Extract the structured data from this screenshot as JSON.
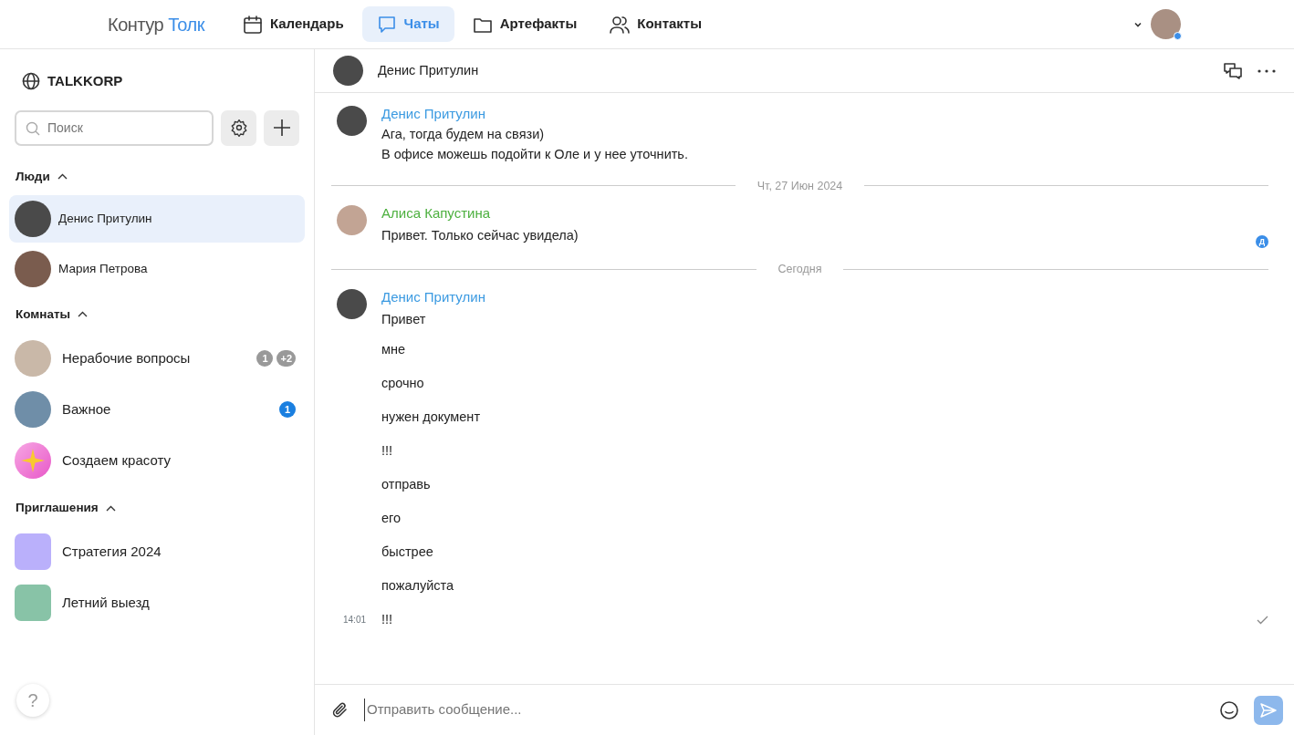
{
  "header": {
    "logo": {
      "brand": "Контур",
      "product": "Толк"
    },
    "nav": [
      {
        "label": "Календарь",
        "selected": false
      },
      {
        "label": "Чаты",
        "selected": true
      },
      {
        "label": "Артефакты",
        "selected": false
      },
      {
        "label": "Контакты",
        "selected": false
      }
    ],
    "user": {
      "online": true
    }
  },
  "sidebar": {
    "workspace": "TALKKORP",
    "search": {
      "placeholder": "Поиск"
    },
    "sections": [
      {
        "title": "Люди",
        "expanded": true,
        "items": [
          {
            "name": "Денис Притулин",
            "kind": "person",
            "selected": true
          },
          {
            "name": "Мария Петрова",
            "kind": "person",
            "selected": false
          }
        ]
      },
      {
        "title": "Комнаты",
        "expanded": true,
        "items": [
          {
            "name": "Нерабочие вопросы",
            "kind": "photo",
            "selected": false,
            "badges": [
              {
                "text": "1",
                "kind": "muted"
              },
              {
                "text": "+2",
                "kind": "muted"
              }
            ]
          },
          {
            "name": "Важное",
            "kind": "photo",
            "selected": false,
            "badges": [
              {
                "text": "1",
                "kind": "unread"
              }
            ]
          },
          {
            "name": "Создаем красоту",
            "kind": "sparkle",
            "selected": false
          }
        ]
      },
      {
        "title": "Приглашения",
        "expanded": true,
        "items": [
          {
            "name": "Стратегия 2024",
            "kind": "color",
            "color": "#bab0fb",
            "selected": false
          },
          {
            "name": "Летний выезд",
            "kind": "color",
            "color": "#88c3a7",
            "selected": false
          }
        ]
      }
    ],
    "help": "?"
  },
  "chat": {
    "title": "Денис Притулин",
    "feed": [
      {
        "kind": "message",
        "author": "Денис Притулин",
        "color": "#3b9ae1",
        "lines": [
          "Ага, тогда будем на связи)",
          "В офисе можешь подойти к Оле и у нее уточнить."
        ]
      },
      {
        "kind": "divider",
        "label": "Чт, 27 Июн 2024"
      },
      {
        "kind": "message",
        "author": "Алиса Капустина",
        "color": "#4db03f",
        "lines": [
          "Привет. Только сейчас увидела)"
        ],
        "seen_by": "Д"
      },
      {
        "kind": "divider",
        "label": "Сегодня"
      },
      {
        "kind": "message",
        "author": "Денис Притулин",
        "color": "#3b9ae1",
        "lines": [
          "Привет",
          "мне",
          "срочно",
          "нужен документ",
          "!!!",
          "отправь",
          "его",
          "быстрее",
          "пожалуйста",
          "!!!"
        ],
        "time": "14:01",
        "delivered": true
      }
    ],
    "composer": {
      "placeholder": "Отправить сообщение..."
    }
  }
}
